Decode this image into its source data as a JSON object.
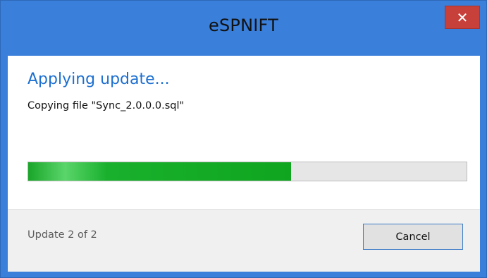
{
  "window": {
    "title": "eSPNIFT",
    "close_symbol": "✕",
    "close_icon": "close-icon"
  },
  "main": {
    "heading": "Applying update...",
    "status": "Copying file \"Sync_2.0.0.0.sql\"",
    "progress_percent": 60
  },
  "footer": {
    "update_count": "Update 2 of 2",
    "cancel_label": "Cancel"
  },
  "colors": {
    "title_bar": "#3a7fd9",
    "close_button": "#c7403a",
    "heading_text": "#1c6fd1",
    "progress_fill": "#0fa51f",
    "progress_track": "#e6e6e6"
  }
}
